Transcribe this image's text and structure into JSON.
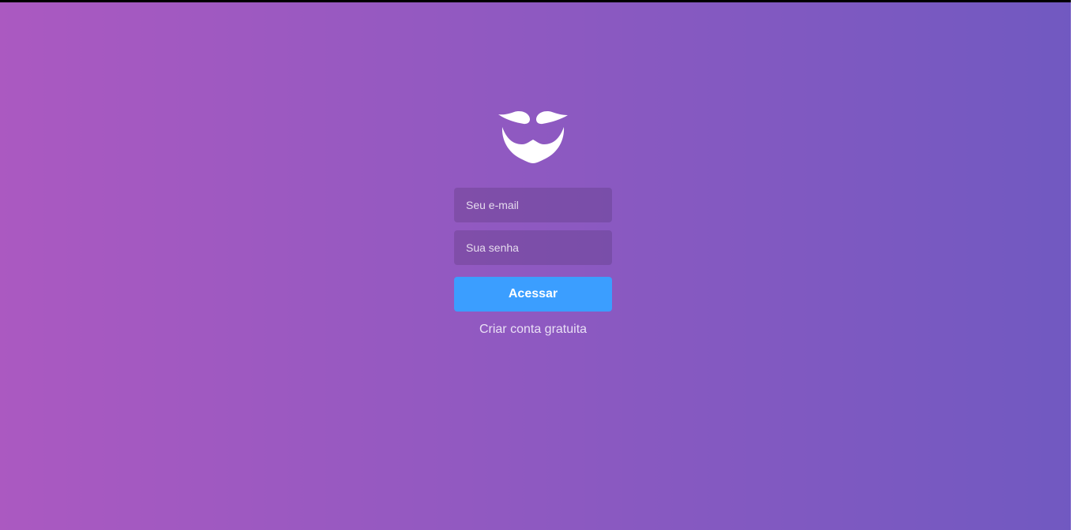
{
  "logo": {
    "icon": "mustache-beard-icon",
    "color": "#ffffff"
  },
  "form": {
    "email_placeholder": "Seu e-mail",
    "email_value": "",
    "password_placeholder": "Sua senha",
    "password_value": "",
    "submit_label": "Acessar",
    "signup_link": "Criar conta gratuita"
  },
  "colors": {
    "gradient_start": "#ab59c1",
    "gradient_end": "#7159c1",
    "button": "#3b9eff"
  }
}
